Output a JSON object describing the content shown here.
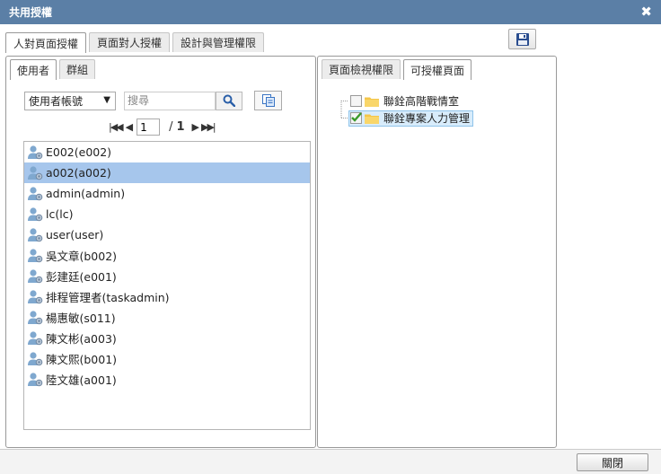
{
  "window": {
    "title": "共用授權"
  },
  "top_tabs": [
    {
      "label": "人對頁面授權",
      "active": true
    },
    {
      "label": "頁面對人授權",
      "active": false
    },
    {
      "label": "設計與管理權限",
      "active": false
    }
  ],
  "left": {
    "sub_tabs": [
      {
        "label": "使用者",
        "active": true
      },
      {
        "label": "群組",
        "active": false
      }
    ],
    "filter_select": {
      "value": "使用者帳號"
    },
    "search": {
      "placeholder": "搜尋",
      "value": ""
    },
    "pager": {
      "current": "1",
      "separator": "/",
      "total": "1"
    },
    "users": [
      {
        "label": "E002(e002)",
        "selected": false
      },
      {
        "label": "a002(a002)",
        "selected": true
      },
      {
        "label": "admin(admin)",
        "selected": false
      },
      {
        "label": "lc(lc)",
        "selected": false
      },
      {
        "label": "user(user)",
        "selected": false
      },
      {
        "label": "吳文章(b002)",
        "selected": false
      },
      {
        "label": "彭建廷(e001)",
        "selected": false
      },
      {
        "label": "排程管理者(taskadmin)",
        "selected": false
      },
      {
        "label": "楊惠敏(s011)",
        "selected": false
      },
      {
        "label": "陳文彬(a003)",
        "selected": false
      },
      {
        "label": "陳文熙(b001)",
        "selected": false
      },
      {
        "label": "陸文雄(a001)",
        "selected": false
      }
    ]
  },
  "right": {
    "sub_tabs": [
      {
        "label": "頁面檢視權限",
        "active": false
      },
      {
        "label": "可授權頁面",
        "active": true
      }
    ],
    "tree": [
      {
        "label": "聯銓高階戰情室",
        "checked": false,
        "selected": false
      },
      {
        "label": "聯銓專案人力管理",
        "checked": true,
        "selected": true
      }
    ]
  },
  "footer": {
    "close_label": "關閉"
  },
  "colors": {
    "titlebar": "#5b7fa6",
    "selection": "#a6c6ec",
    "check": "#3a9a2a",
    "folder": "#f4c64a"
  }
}
